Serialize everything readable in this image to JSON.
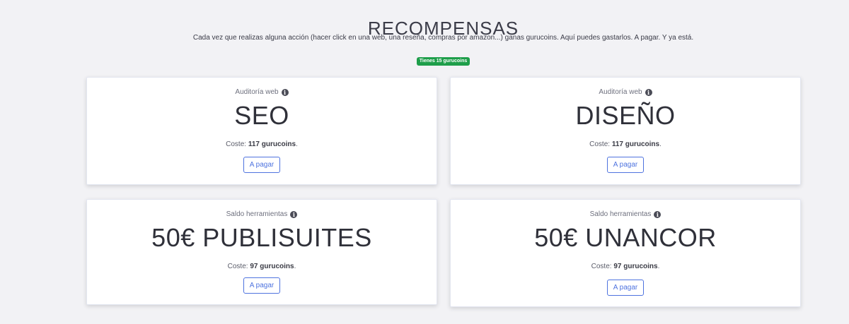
{
  "header": {
    "title": "RECOMPENSAS",
    "subtitle": "Cada vez que realizas alguna acción (hacer click en una web, una reseña, compras por amazon...) ganas gurucoins. Aquí puedes gastarlos. A pagar. Y ya está.",
    "balance_badge": "Tienes 15 gurucoins",
    "badge_color": "#1e9e4a"
  },
  "accent_color": "#4e73df",
  "rewards": [
    {
      "category": "Auditoría web",
      "title": "SEO",
      "cost_label": "Coste:",
      "cost_value": "117 gurucoins",
      "cost_suffix": ".",
      "button_label": "A pagar"
    },
    {
      "category": "Auditoría web",
      "title": "DISEÑO",
      "cost_label": "Coste:",
      "cost_value": "117 gurucoins",
      "cost_suffix": ".",
      "button_label": "A pagar"
    },
    {
      "category": "Saldo herramientas",
      "title": "50€ PUBLISUITES",
      "cost_label": "Coste:",
      "cost_value": "97 gurucoins",
      "cost_suffix": ".",
      "button_label": "A pagar"
    },
    {
      "category": "Saldo herramientas",
      "title": "50€ UNANCOR",
      "cost_label": "Coste:",
      "cost_value": "97 gurucoins",
      "cost_suffix": ".",
      "button_label": "A pagar"
    }
  ],
  "icons": {
    "info": "info-circle-icon"
  }
}
